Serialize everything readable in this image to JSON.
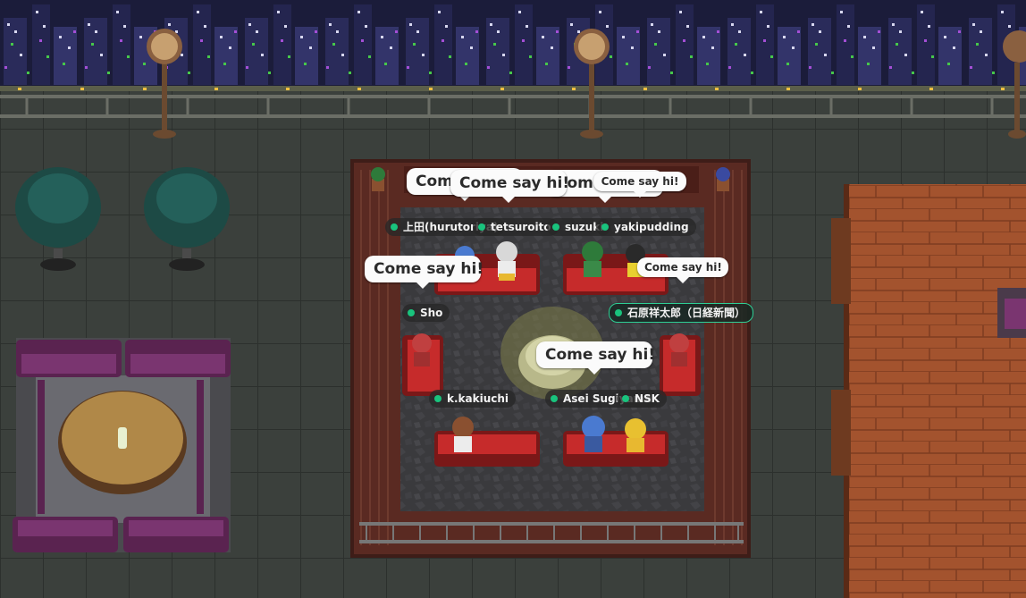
{
  "players": [
    {
      "name": "上田(hurutoriya)",
      "status_color": "#19c37d"
    },
    {
      "name": "tetsuroito",
      "status_color": "#19c37d"
    },
    {
      "name": "suzuki",
      "status_color": "#19c37d"
    },
    {
      "name": "yakipudding",
      "status_color": "#19c37d"
    },
    {
      "name": "Sho",
      "status_color": "#19c37d"
    },
    {
      "name": "石原祥太郎（日経新聞）",
      "status_color": "#19c37d"
    },
    {
      "name": "k.kakiuchi",
      "status_color": "#19c37d"
    },
    {
      "name": "Asei Sugiyama",
      "status_color": "#19c37d"
    },
    {
      "name": "NSK",
      "status_color": "#19c37d"
    }
  ],
  "bubbles": [
    {
      "text": "Come say hi!"
    },
    {
      "text": "Come say hi!"
    },
    {
      "text": "Come say hi!"
    },
    {
      "text": "Come say hi!"
    },
    {
      "text": "Come say hi!"
    },
    {
      "text": "Come say hi!"
    },
    {
      "text": "Come say hi!"
    }
  ],
  "colors": {
    "status_online": "#19c37d",
    "selected_border": "#2ecf95",
    "sofa_red": "#c62b2b",
    "sofa_purple": "#5a2350",
    "floor_wood": "#a3532e"
  },
  "icons": [
    "lamp-post-icon",
    "tree-icon",
    "sofa-icon",
    "plant-icon",
    "fountain-icon",
    "avatar-icon"
  ]
}
